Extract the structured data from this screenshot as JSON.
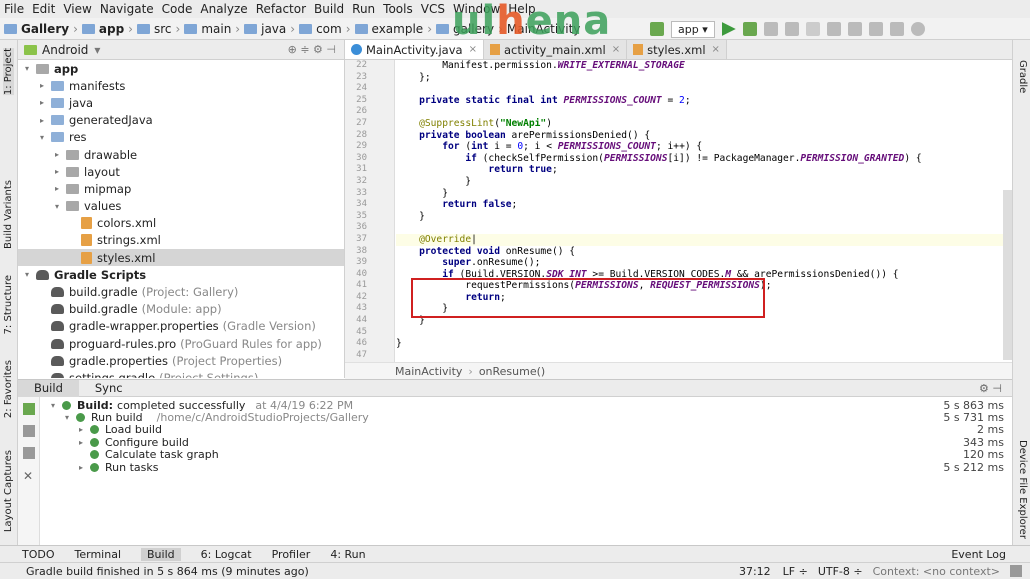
{
  "menu": [
    "File",
    "Edit",
    "View",
    "Navigate",
    "Code",
    "Analyze",
    "Refactor",
    "Build",
    "Run",
    "Tools",
    "VCS",
    "Window",
    "Help"
  ],
  "breadcrumb": [
    "Gallery",
    "app",
    "src",
    "main",
    "java",
    "com",
    "example",
    "gallery",
    "MainActivity"
  ],
  "watermark": {
    "text_a": "ul",
    "text_b": "h",
    "text_c": "ena"
  },
  "run_config": "app",
  "left_strip": {
    "project": "1: Project",
    "build_variants": "Build Variants",
    "structure": "7: Structure",
    "favorites": "2: Favorites",
    "captures": "Layout Captures"
  },
  "right_strip": {
    "gradle": "Gradle",
    "explorer": "Device File Explorer"
  },
  "project_panel": {
    "view": "Android",
    "rows": [
      {
        "label": "app",
        "note": "",
        "indent": 0,
        "kind": "folder-gray",
        "arrow": "▾"
      },
      {
        "label": "manifests",
        "note": "",
        "indent": 1,
        "kind": "folder",
        "arrow": "▸"
      },
      {
        "label": "java",
        "note": "",
        "indent": 1,
        "kind": "folder",
        "arrow": "▸"
      },
      {
        "label": "generatedJava",
        "note": "",
        "indent": 1,
        "kind": "folder",
        "arrow": "▸"
      },
      {
        "label": "res",
        "note": "",
        "indent": 1,
        "kind": "folder",
        "arrow": "▾"
      },
      {
        "label": "drawable",
        "note": "",
        "indent": 2,
        "kind": "folder-gray",
        "arrow": "▸"
      },
      {
        "label": "layout",
        "note": "",
        "indent": 2,
        "kind": "folder-gray",
        "arrow": "▸"
      },
      {
        "label": "mipmap",
        "note": "",
        "indent": 2,
        "kind": "folder-gray",
        "arrow": "▸"
      },
      {
        "label": "values",
        "note": "",
        "indent": 2,
        "kind": "folder-gray",
        "arrow": "▾"
      },
      {
        "label": "colors.xml",
        "note": "",
        "indent": 3,
        "kind": "xml",
        "arrow": ""
      },
      {
        "label": "strings.xml",
        "note": "",
        "indent": 3,
        "kind": "xml",
        "arrow": ""
      },
      {
        "label": "styles.xml",
        "note": "",
        "indent": 3,
        "kind": "xml",
        "arrow": "",
        "selected": true
      },
      {
        "label": "Gradle Scripts",
        "note": "",
        "indent": 0,
        "kind": "gradle",
        "arrow": "▾"
      },
      {
        "label": "build.gradle",
        "note": "(Project: Gallery)",
        "indent": 1,
        "kind": "gradle",
        "arrow": ""
      },
      {
        "label": "build.gradle",
        "note": "(Module: app)",
        "indent": 1,
        "kind": "gradle",
        "arrow": ""
      },
      {
        "label": "gradle-wrapper.properties",
        "note": "(Gradle Version)",
        "indent": 1,
        "kind": "gradle",
        "arrow": ""
      },
      {
        "label": "proguard-rules.pro",
        "note": "(ProGuard Rules for app)",
        "indent": 1,
        "kind": "gradle",
        "arrow": ""
      },
      {
        "label": "gradle.properties",
        "note": "(Project Properties)",
        "indent": 1,
        "kind": "gradle",
        "arrow": ""
      },
      {
        "label": "settings.gradle",
        "note": "(Project Settings)",
        "indent": 1,
        "kind": "gradle",
        "arrow": ""
      }
    ]
  },
  "editor": {
    "tabs": [
      {
        "label": "MainActivity.java",
        "icon": "java"
      },
      {
        "label": "activity_main.xml",
        "icon": "xml"
      },
      {
        "label": "styles.xml",
        "icon": "xml"
      }
    ],
    "line_numbers": [
      "22",
      "23",
      "24",
      "25",
      "26",
      "27",
      "28",
      "29",
      "30",
      "31",
      "32",
      "33",
      "34",
      "35",
      "36",
      "37",
      "38",
      "39",
      "40",
      "41",
      "42",
      "43",
      "44",
      "45",
      "46",
      "47"
    ],
    "breadcrumb": [
      "MainActivity",
      "onResume()"
    ]
  },
  "build_panel": {
    "tabs": [
      "Build",
      "Sync"
    ],
    "rows": [
      {
        "label": "Build:",
        "label2": "completed successfully",
        "note": "at 4/4/19 6:22 PM",
        "time": "5 s 863 ms",
        "indent": 0,
        "arrow": "▾"
      },
      {
        "label": "Run build",
        "label2": "",
        "note": "/home/c/AndroidStudioProjects/Gallery",
        "time": "5 s 731 ms",
        "indent": 1,
        "arrow": "▾"
      },
      {
        "label": "Load build",
        "label2": "",
        "note": "",
        "time": "2 ms",
        "indent": 2,
        "arrow": "▸"
      },
      {
        "label": "Configure build",
        "label2": "",
        "note": "",
        "time": "343 ms",
        "indent": 2,
        "arrow": "▸"
      },
      {
        "label": "Calculate task graph",
        "label2": "",
        "note": "",
        "time": "120 ms",
        "indent": 2,
        "arrow": ""
      },
      {
        "label": "Run tasks",
        "label2": "",
        "note": "",
        "time": "5 s 212 ms",
        "indent": 2,
        "arrow": "▸"
      }
    ]
  },
  "bottom_tabs": [
    "TODO",
    "Terminal",
    "Build",
    "6: Logcat",
    "Profiler",
    "4: Run"
  ],
  "event_log": "Event Log",
  "status": {
    "message": "Gradle build finished in 5 s 864 ms (9 minutes ago)",
    "position": "37:12",
    "line_sep": "LF ÷",
    "encoding": "UTF-8 ÷",
    "context": "Context: <no context>"
  }
}
